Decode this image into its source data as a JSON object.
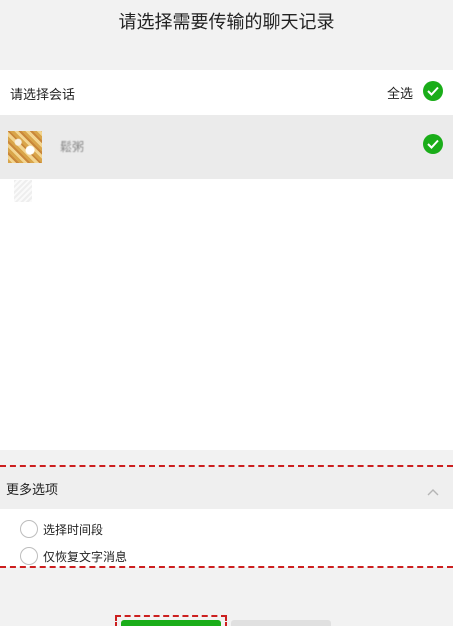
{
  "page": {
    "title": "请选择需要传输的聊天记录"
  },
  "selection": {
    "header_label": "请选择会话",
    "select_all_label": "全选",
    "accent_color": "#1aad19"
  },
  "chats": [
    {
      "name": "鬆粥",
      "selected": true,
      "avatar_icon": "avatar-image"
    }
  ],
  "more_options": {
    "label": "更多选项",
    "expanded": true,
    "toggle_icon": "chevron-up-icon",
    "options": [
      {
        "label": "选择时间段",
        "checked": false
      },
      {
        "label": "仅恢复文字消息",
        "checked": false
      }
    ]
  },
  "highlight_color": "#cc1f1f"
}
